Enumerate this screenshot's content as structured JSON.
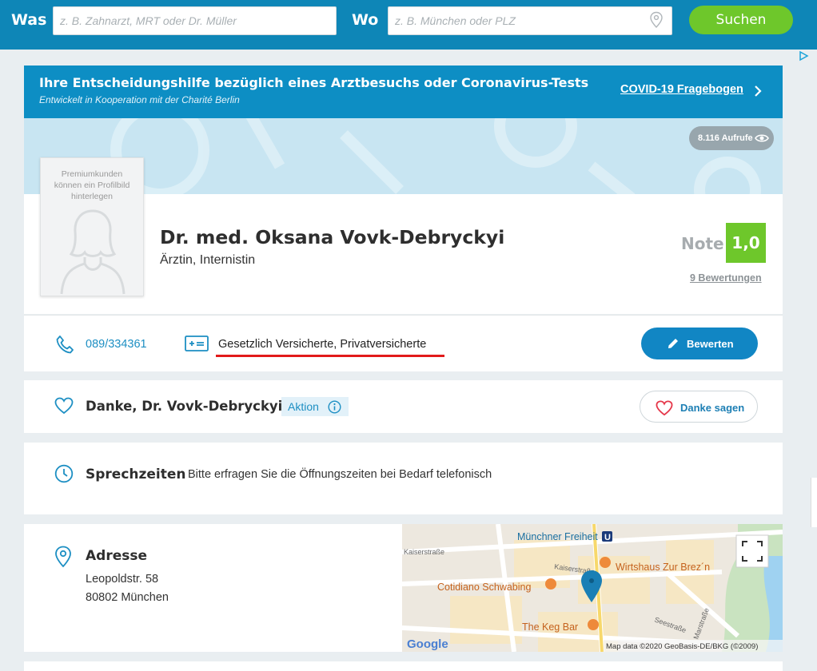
{
  "search": {
    "was_label": "Was",
    "was_placeholder": "z. B. Zahnarzt, MRT oder Dr. Müller",
    "wo_label": "Wo",
    "wo_placeholder": "z. B. München oder PLZ",
    "button_label": "Suchen"
  },
  "banner": {
    "title": "Ihre Entscheidungshilfe bezüglich eines Arztbesuchs oder Coronavirus-Tests",
    "subtitle": "Entwickelt in Kooperation mit der Charité Berlin",
    "link_label": "COVID-19 Fragebogen"
  },
  "profile": {
    "views": "8.116 Aufrufe",
    "avatar_text_1": "Premiumkunden",
    "avatar_text_2": "können ein Profilbild",
    "avatar_text_3": "hinterlegen",
    "name": "Dr. med. Oksana Vovk-Debryckyi",
    "role": "Ärztin, Internistin",
    "note_label": "Note",
    "note_value": "1,0",
    "reviews": "9 Bewertungen"
  },
  "contact": {
    "phone": "089/334361",
    "insurance": "Gesetzlich Versicherte, Privatversicherte",
    "rate_label": "Bewerten"
  },
  "thanks": {
    "text": "Danke, Dr. Vovk-Debryckyi!",
    "aktion_label": "Aktion",
    "button_label": "Danke sagen"
  },
  "hours": {
    "title": "Sprechzeiten",
    "text": "Bitte erfragen Sie die Öffnungszeiten bei Bedarf telefonisch"
  },
  "address": {
    "title": "Adresse",
    "street": "Leopoldstr. 58",
    "city": "80802 München"
  },
  "map": {
    "station": "Münchner Freiheit",
    "street_1": "Kaiserstraße",
    "street_2": "Kaiserstraße",
    "place_1": "Wirtshaus Zur Brez´n",
    "place_2": "Cotidiano Schwabing",
    "place_3": "The Keg Bar",
    "street_3": "Seestraße",
    "street_4": "Marstraße",
    "logo": "Google",
    "attribution": "Map data ©2020 GeoBasis-DE/BKG (©2009)"
  },
  "colors": {
    "brand_blue": "#0e86b7",
    "accent_green": "#6ec72b",
    "highlight_red": "#e21a1a"
  }
}
